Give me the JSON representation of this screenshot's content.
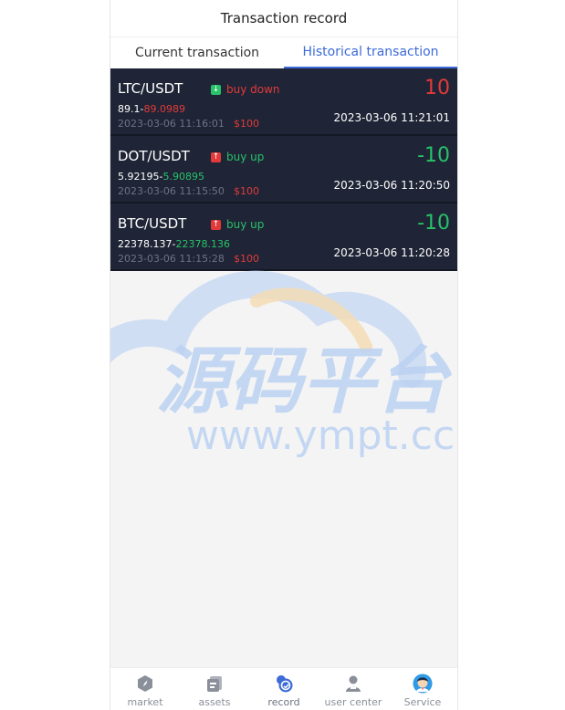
{
  "header": {
    "title": "Transaction record"
  },
  "tabs": [
    {
      "label": "Current transaction",
      "active": false
    },
    {
      "label": "Historical transaction",
      "active": true
    }
  ],
  "records": [
    {
      "pair": "LTC/USDT",
      "direction": "buy down",
      "direction_type": "down",
      "open_price": "89.1",
      "separator": "-",
      "close_price": "89.0989",
      "close_price_color": "#e23a3a",
      "open_time": "2023-03-06 11:16:01",
      "amount": "$100",
      "pnl": "10",
      "pnl_color": "#e23a3a",
      "close_time": "2023-03-06 11:21:01"
    },
    {
      "pair": "DOT/USDT",
      "direction": "buy up",
      "direction_type": "up",
      "open_price": "5.92195",
      "separator": "-",
      "close_price": "5.90895",
      "close_price_color": "#27c26a",
      "open_time": "2023-03-06 11:15:50",
      "amount": "$100",
      "pnl": "-10",
      "pnl_color": "#27c26a",
      "close_time": "2023-03-06 11:20:50"
    },
    {
      "pair": "BTC/USDT",
      "direction": "buy up",
      "direction_type": "up",
      "open_price": "22378.137",
      "separator": "-",
      "close_price": "22378.136",
      "close_price_color": "#27c26a",
      "open_time": "2023-03-06 11:15:28",
      "amount": "$100",
      "pnl": "-10",
      "pnl_color": "#27c26a",
      "close_time": "2023-03-06 11:20:28"
    }
  ],
  "watermark": {
    "title": "源码平台",
    "url": "www.ympt.cc"
  },
  "tabbar": {
    "items": [
      {
        "label": "market",
        "icon": "compass-icon"
      },
      {
        "label": "assets",
        "icon": "wallet-icon"
      },
      {
        "label": "record",
        "icon": "record-icon"
      },
      {
        "label": "user center",
        "icon": "user-icon"
      },
      {
        "label": "Service",
        "icon": "service-avatar-icon"
      }
    ],
    "active_index": 2
  },
  "colors": {
    "accent": "#3d6bd8",
    "card_bg": "#1f2536",
    "up": "#27c26a",
    "down": "#e23a3a"
  }
}
